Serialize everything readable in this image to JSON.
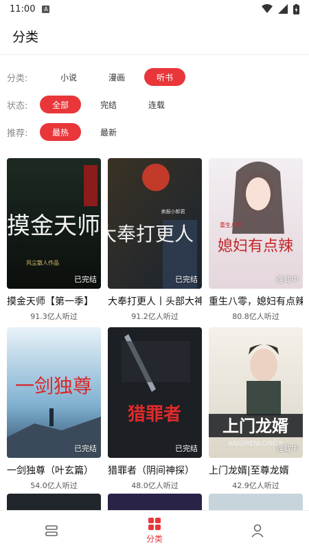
{
  "status_bar": {
    "time": "11:00",
    "badge": "A"
  },
  "app_bar": {
    "title": "分类"
  },
  "filters": {
    "category": {
      "label": "分类:",
      "options": [
        "小说",
        "漫画",
        "听书"
      ],
      "selected": "听书"
    },
    "status": {
      "label": "状态:",
      "options": [
        "全部",
        "完结",
        "连载"
      ],
      "selected": "全部"
    },
    "sort": {
      "label": "推荐:",
      "options": [
        "最热",
        "最新"
      ],
      "selected": "最热"
    }
  },
  "books": [
    {
      "title": "摸金天师【第一季】",
      "stats": "91.3亿人听过",
      "state": "已完结",
      "cover_text": "摸金天师",
      "cover_sub": "风尘散人作品"
    },
    {
      "title": "大奉打更人丨头部大神",
      "stats": "91.2亿人听过",
      "state": "已完结",
      "cover_text": "大奉打更人",
      "cover_sub": "卖报小郎君"
    },
    {
      "title": "重生八零，媳妇有点辣",
      "stats": "80.8亿人听过",
      "state": "连载中",
      "cover_text": "媳妇有点辣",
      "cover_sub": "重生八零"
    },
    {
      "title": "一剑独尊（叶玄篇）",
      "stats": "54.0亿人听过",
      "state": "已完结",
      "cover_text": "一剑独尊",
      "cover_sub": ""
    },
    {
      "title": "猎罪者（阴间神探）",
      "stats": "48.0亿人听过",
      "state": "已完结",
      "cover_text": "猎罪者",
      "cover_sub": ""
    },
    {
      "title": "上门龙婿|至尊龙婿",
      "stats": "42.9亿人听过",
      "state": "连载中",
      "cover_text": "上门龙婿",
      "cover_sub": "ANGMENLONGX"
    }
  ],
  "bottom_nav": {
    "active_label": "分类"
  },
  "colors": {
    "accent": "#e8363a"
  }
}
